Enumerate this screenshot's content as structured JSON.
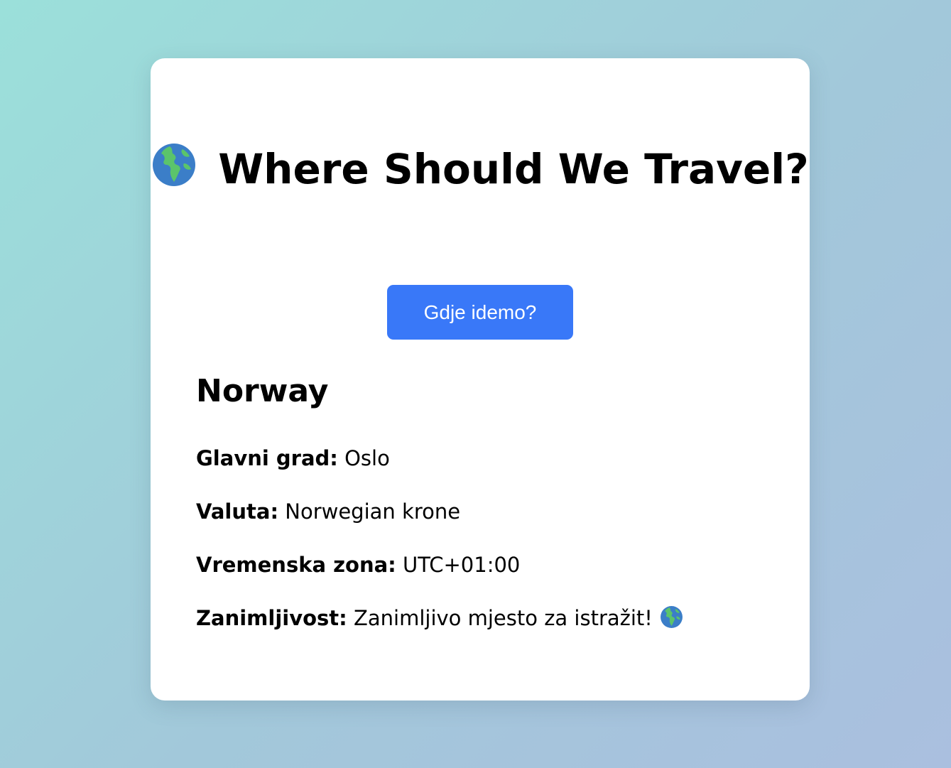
{
  "header": {
    "title": "Where Should We Travel?",
    "title_icon": "globe-icon"
  },
  "actions": {
    "random_button_label": "Gdje idemo?"
  },
  "country": {
    "name": "Norway",
    "details": [
      {
        "label": "Glavni grad:",
        "value": "Oslo"
      },
      {
        "label": "Valuta:",
        "value": "Norwegian krone"
      },
      {
        "label": "Vremenska zona:",
        "value": "UTC+01:00"
      },
      {
        "label": "Zanimljivost:",
        "value": "Zanimljivo mjesto za istražit!",
        "icon": "globe-icon"
      }
    ]
  },
  "colors": {
    "accent": "#3978f8",
    "card_background": "#ffffff",
    "page_gradient_start": "#9be0da",
    "page_gradient_end": "#aabfdf"
  }
}
